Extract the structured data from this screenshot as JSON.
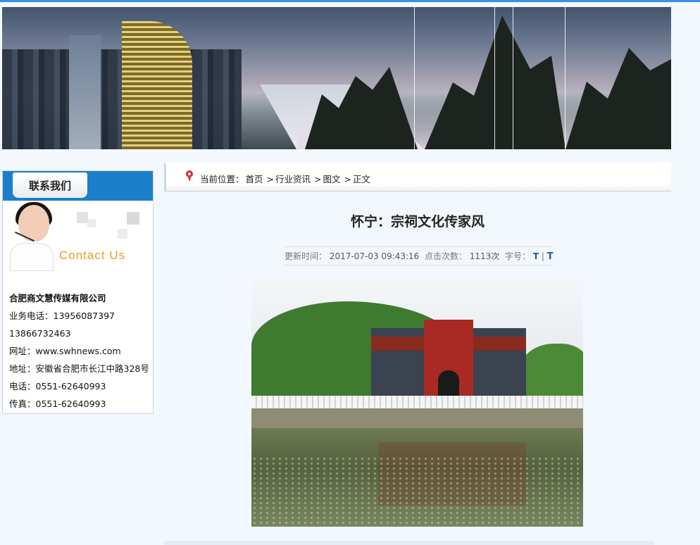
{
  "banner": {
    "alt": "合肥城市与山景横幅"
  },
  "sidebar": {
    "header_label": "联系我们",
    "contact_image_text": "Contact Us",
    "company": "合肥商文慧传媒有限公司",
    "lines": [
      "业务电话：13956087397",
      "13866732463",
      "网址：www.swhnews.com",
      "地址：安徽省合肥市长江中路328号",
      "电话：0551-62640993",
      "传真：0551-62640993"
    ]
  },
  "breadcrumb": {
    "prefix": "当前位置：",
    "items": [
      "首页",
      "行业资讯",
      "图文",
      "正文"
    ],
    "separator": ">"
  },
  "article": {
    "title": "怀宁：宗祠文化传家风",
    "meta": {
      "updated_label": "更新时间：",
      "updated_value": "2017-07-03 09:43:16",
      "clicks_label": "点击次数：",
      "clicks_value": "1113次",
      "fontsize_label": "字号：",
      "font_small": "T",
      "font_divider": "|",
      "font_large": "T"
    }
  },
  "colors": {
    "accent": "#1c7fc9",
    "pin": "#d7282e",
    "contact_orange": "#f09a1c"
  },
  "icons": {
    "breadcrumb": "location-pin-icon"
  }
}
